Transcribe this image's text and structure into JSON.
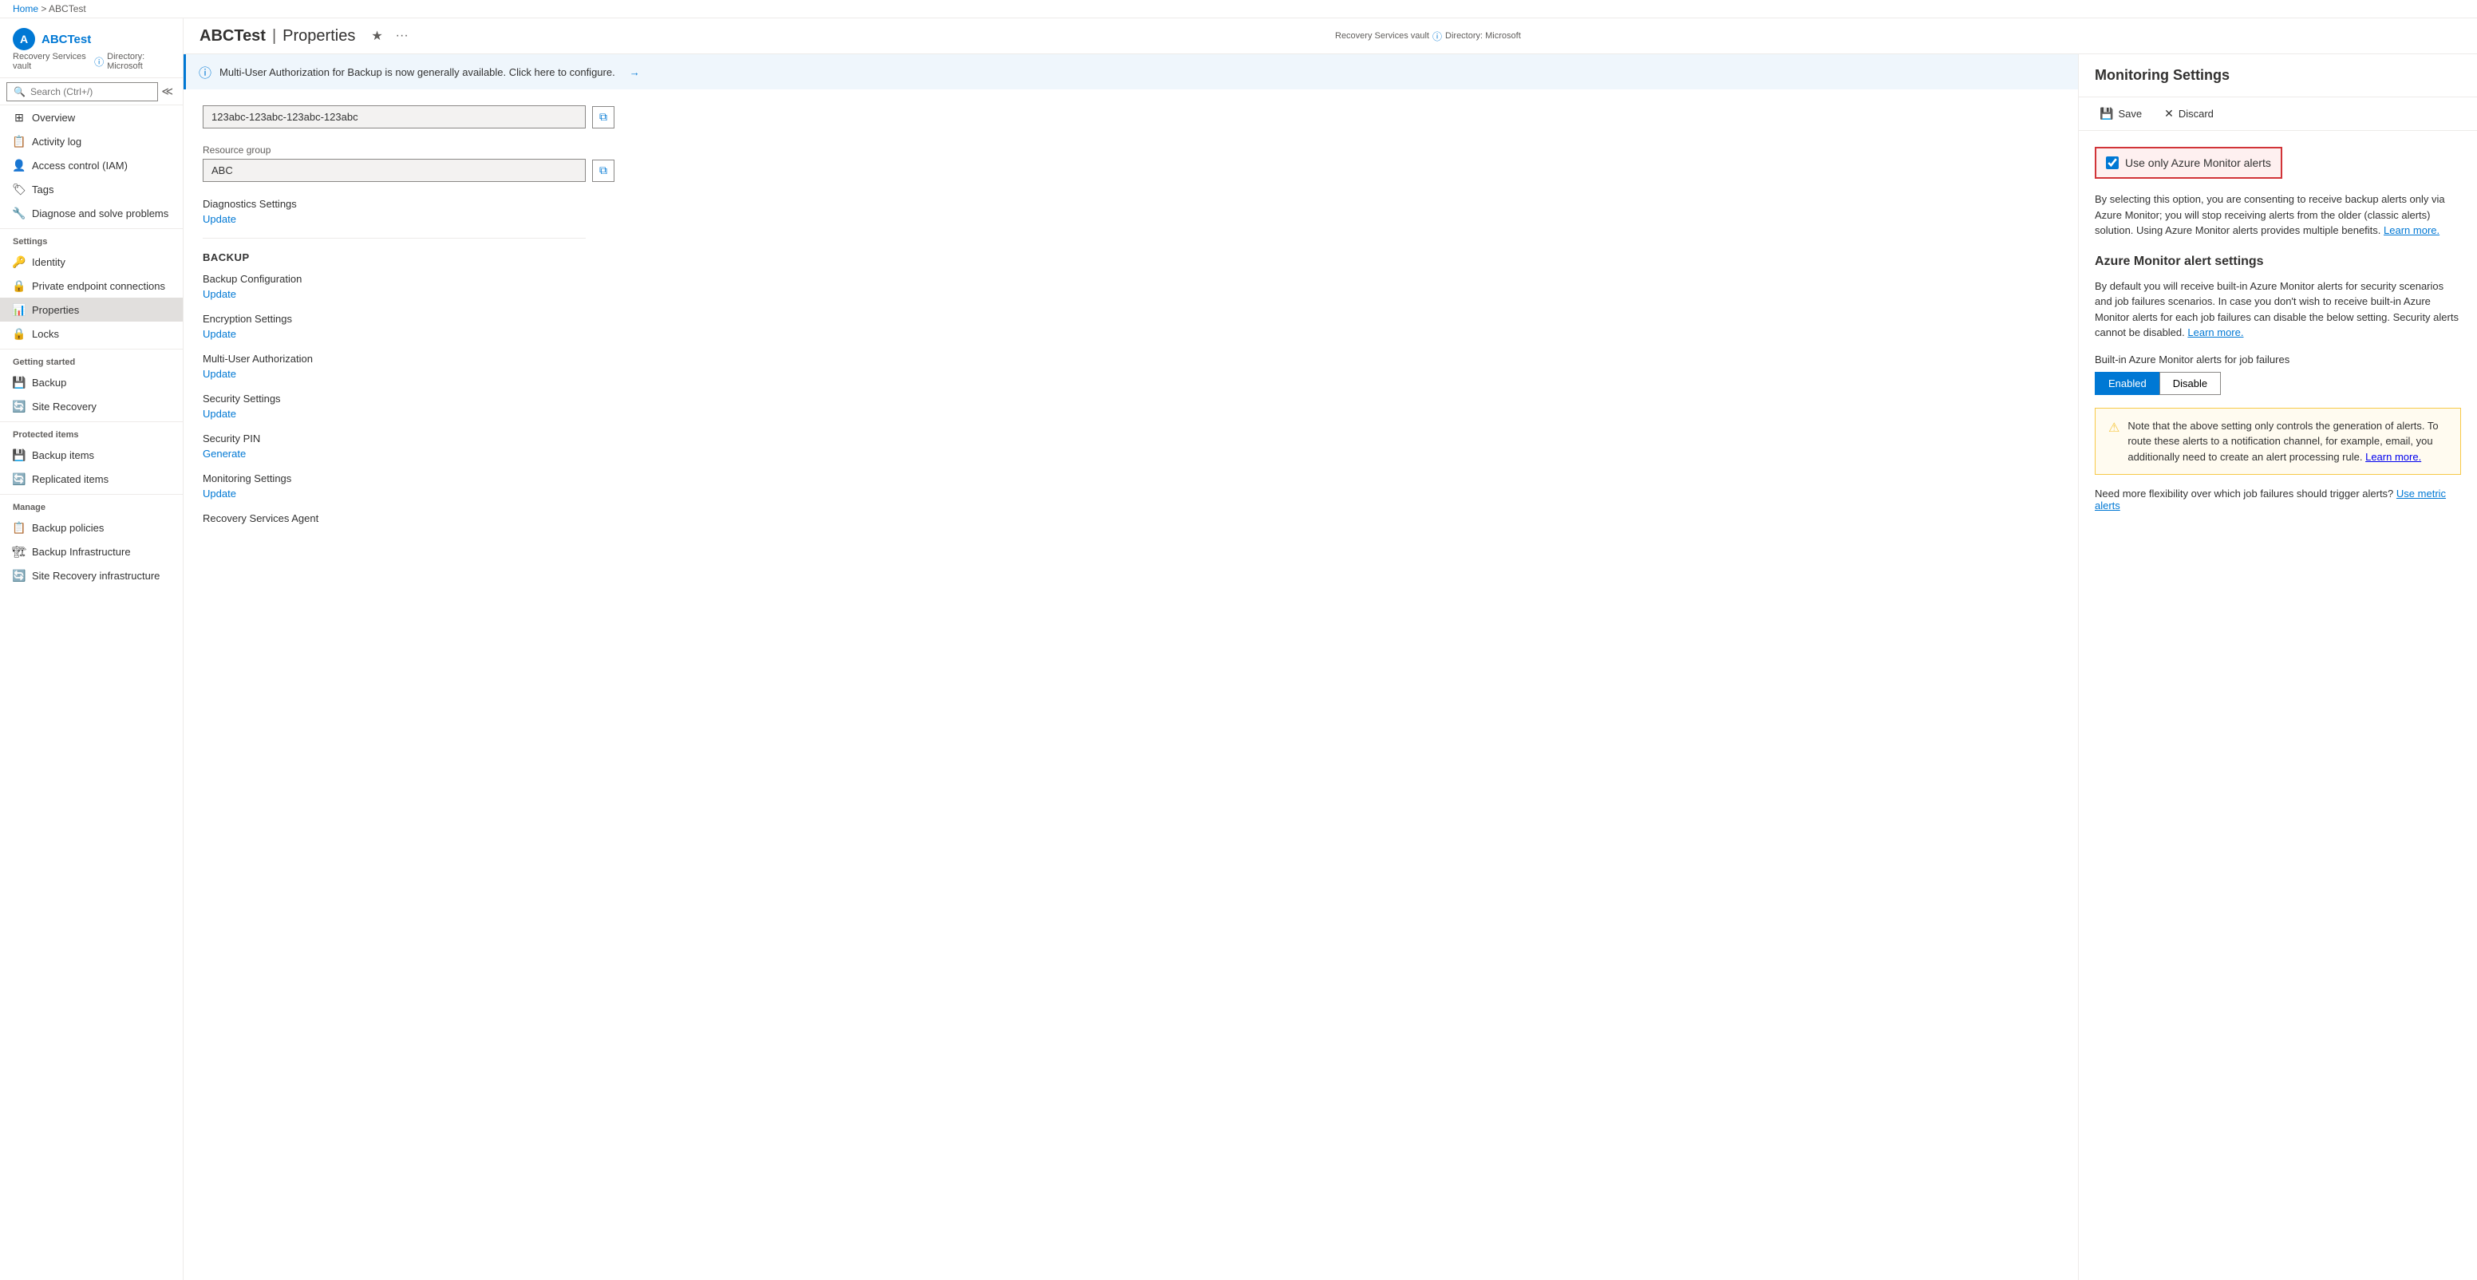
{
  "breadcrumb": {
    "home": "Home",
    "current": "ABCTest"
  },
  "sidebar": {
    "resource_name": "ABCTest",
    "resource_type": "Recovery Services vault",
    "directory": "Directory: Microsoft",
    "search_placeholder": "Search (Ctrl+/)",
    "collapse_tooltip": "Collapse",
    "nav_items": [
      {
        "id": "overview",
        "label": "Overview",
        "icon": "⊞"
      },
      {
        "id": "activity-log",
        "label": "Activity log",
        "icon": "📋"
      },
      {
        "id": "access-control",
        "label": "Access control (IAM)",
        "icon": "👤"
      },
      {
        "id": "tags",
        "label": "Tags",
        "icon": "🏷"
      },
      {
        "id": "diagnose",
        "label": "Diagnose and solve problems",
        "icon": "🔧"
      }
    ],
    "settings_label": "Settings",
    "settings_items": [
      {
        "id": "identity",
        "label": "Identity",
        "icon": "🔑"
      },
      {
        "id": "private-endpoint",
        "label": "Private endpoint connections",
        "icon": "🔒"
      },
      {
        "id": "properties",
        "label": "Properties",
        "icon": "📊",
        "active": true
      },
      {
        "id": "locks",
        "label": "Locks",
        "icon": "🔒"
      }
    ],
    "getting_started_label": "Getting started",
    "getting_started_items": [
      {
        "id": "backup",
        "label": "Backup",
        "icon": "💾"
      },
      {
        "id": "site-recovery",
        "label": "Site Recovery",
        "icon": "🔄"
      }
    ],
    "protected_items_label": "Protected items",
    "protected_items": [
      {
        "id": "backup-items",
        "label": "Backup items",
        "icon": "💾"
      },
      {
        "id": "replicated-items",
        "label": "Replicated items",
        "icon": "🔄"
      }
    ],
    "manage_label": "Manage",
    "manage_items": [
      {
        "id": "backup-policies",
        "label": "Backup policies",
        "icon": "📋"
      },
      {
        "id": "backup-infrastructure",
        "label": "Backup Infrastructure",
        "icon": "🏗"
      },
      {
        "id": "site-recovery-infra",
        "label": "Site Recovery infrastructure",
        "icon": "🔄"
      }
    ]
  },
  "page_header": {
    "resource_name": "ABCTest",
    "separator": "|",
    "page_title": "Properties",
    "subtitle": "Recovery Services vault",
    "directory": "Directory: Microsoft"
  },
  "info_banner": {
    "message": "Multi-User Authorization for Backup is now generally available. Click here to configure.",
    "arrow": "→"
  },
  "properties": {
    "subscription_id": "123abc-123abc-123abc-123abc",
    "resource_group_label": "Resource group",
    "resource_group": "ABC",
    "diagnostics_label": "Diagnostics Settings",
    "diagnostics_link": "Update",
    "section_backup": "BACKUP",
    "backup_config_label": "Backup Configuration",
    "backup_config_link": "Update",
    "encryption_label": "Encryption Settings",
    "encryption_link": "Update",
    "multi_user_label": "Multi-User Authorization",
    "multi_user_link": "Update",
    "security_settings_label": "Security Settings",
    "security_settings_link": "Update",
    "security_pin_label": "Security PIN",
    "security_pin_link": "Generate",
    "monitoring_label": "Monitoring Settings",
    "monitoring_link": "Update",
    "recovery_agent_label": "Recovery Services Agent"
  },
  "monitoring_settings": {
    "title": "Monitoring Settings",
    "save_label": "Save",
    "discard_label": "Discard",
    "checkbox_label": "Use only Azure Monitor alerts",
    "checkbox_checked": true,
    "description": "By selecting this option, you are consenting to receive backup alerts only via Azure Monitor; you will stop receiving alerts from the older (classic alerts) solution. Using Azure Monitor alerts provides multiple benefits.",
    "learn_more_1": "Learn more.",
    "section_title": "Azure Monitor alert settings",
    "alert_description": "By default you will receive built-in Azure Monitor alerts for security scenarios and job failures scenarios. In case you don't wish to receive built-in Azure Monitor alerts for each job failures can disable the below setting. Security alerts cannot be disabled.",
    "learn_more_2": "Learn more.",
    "built_in_label": "Built-in Azure Monitor alerts for job failures",
    "toggle_enabled": "Enabled",
    "toggle_disable": "Disable",
    "warning_text": "Note that the above setting only controls the generation of alerts. To route these alerts to a notification channel, for example, email, you additionally need to create an alert processing rule.",
    "learn_more_3": "Learn more.",
    "flexibility_text": "Need more flexibility over which job failures should trigger alerts?",
    "use_metric_link": "Use metric alerts"
  }
}
